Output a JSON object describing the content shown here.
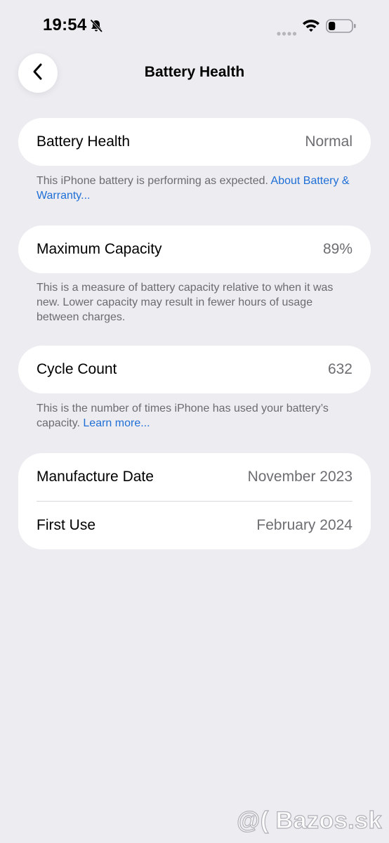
{
  "status_bar": {
    "time": "19:54",
    "icons": [
      "bell-slash-icon",
      "signal-icon",
      "wifi-icon",
      "battery-icon"
    ],
    "battery_level": 0.3
  },
  "nav": {
    "back_icon": "chevron-left-icon",
    "title": "Battery Health"
  },
  "health": {
    "label": "Battery Health",
    "value": "Normal",
    "footnote": "This iPhone battery is performing as expected.",
    "link": "About Battery & Warranty..."
  },
  "capacity": {
    "label": "Maximum Capacity",
    "value": "89%",
    "footnote": "This is a measure of battery capacity relative to when it was new. Lower capacity may result in fewer hours of usage between charges."
  },
  "cycles": {
    "label": "Cycle Count",
    "value": "632",
    "footnote": "This is the number of times iPhone has used your battery’s capacity.",
    "link": "Learn more..."
  },
  "dates": {
    "manufacture_label": "Manufacture Date",
    "manufacture_value": "November 2023",
    "first_use_label": "First Use",
    "first_use_value": "February 2024"
  },
  "watermark": "@( Bazos.sk",
  "colors": {
    "background": "#ececf1",
    "card": "#ffffff",
    "link": "#1f6fd6",
    "secondary_text": "#6d6d72"
  }
}
